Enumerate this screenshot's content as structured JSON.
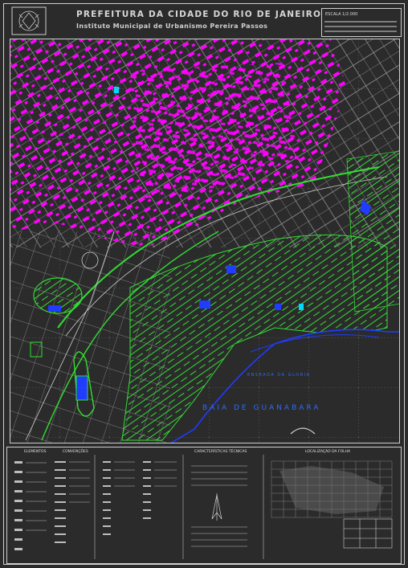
{
  "header": {
    "title": "PREFEITURA DA CIDADE DO RIO DE JANEIRO",
    "subtitle": "Instituto Municipal de Urbanismo Pereira Passos",
    "scale": "ESCALA 1/2.000"
  },
  "map": {
    "bay_label": "BAIA DE GUANABARA",
    "cove_label": "ENSEADA DA GLORIA"
  },
  "legend": {
    "col1_title": "ELEMENTOS",
    "col2_title": "CONVENÇÕES",
    "technical_title": "CARACTERÍSTICAS TÉCNICAS",
    "location_title": "LOCALIZAÇÃO DA FOLHA"
  },
  "colors": {
    "background": "#2b2b2b",
    "street_lines": "#bdbdbd",
    "buildings": "#ff00ff",
    "vegetation": "#33dd33",
    "water": "#1f3cff",
    "grid": "#9a9a9a"
  }
}
